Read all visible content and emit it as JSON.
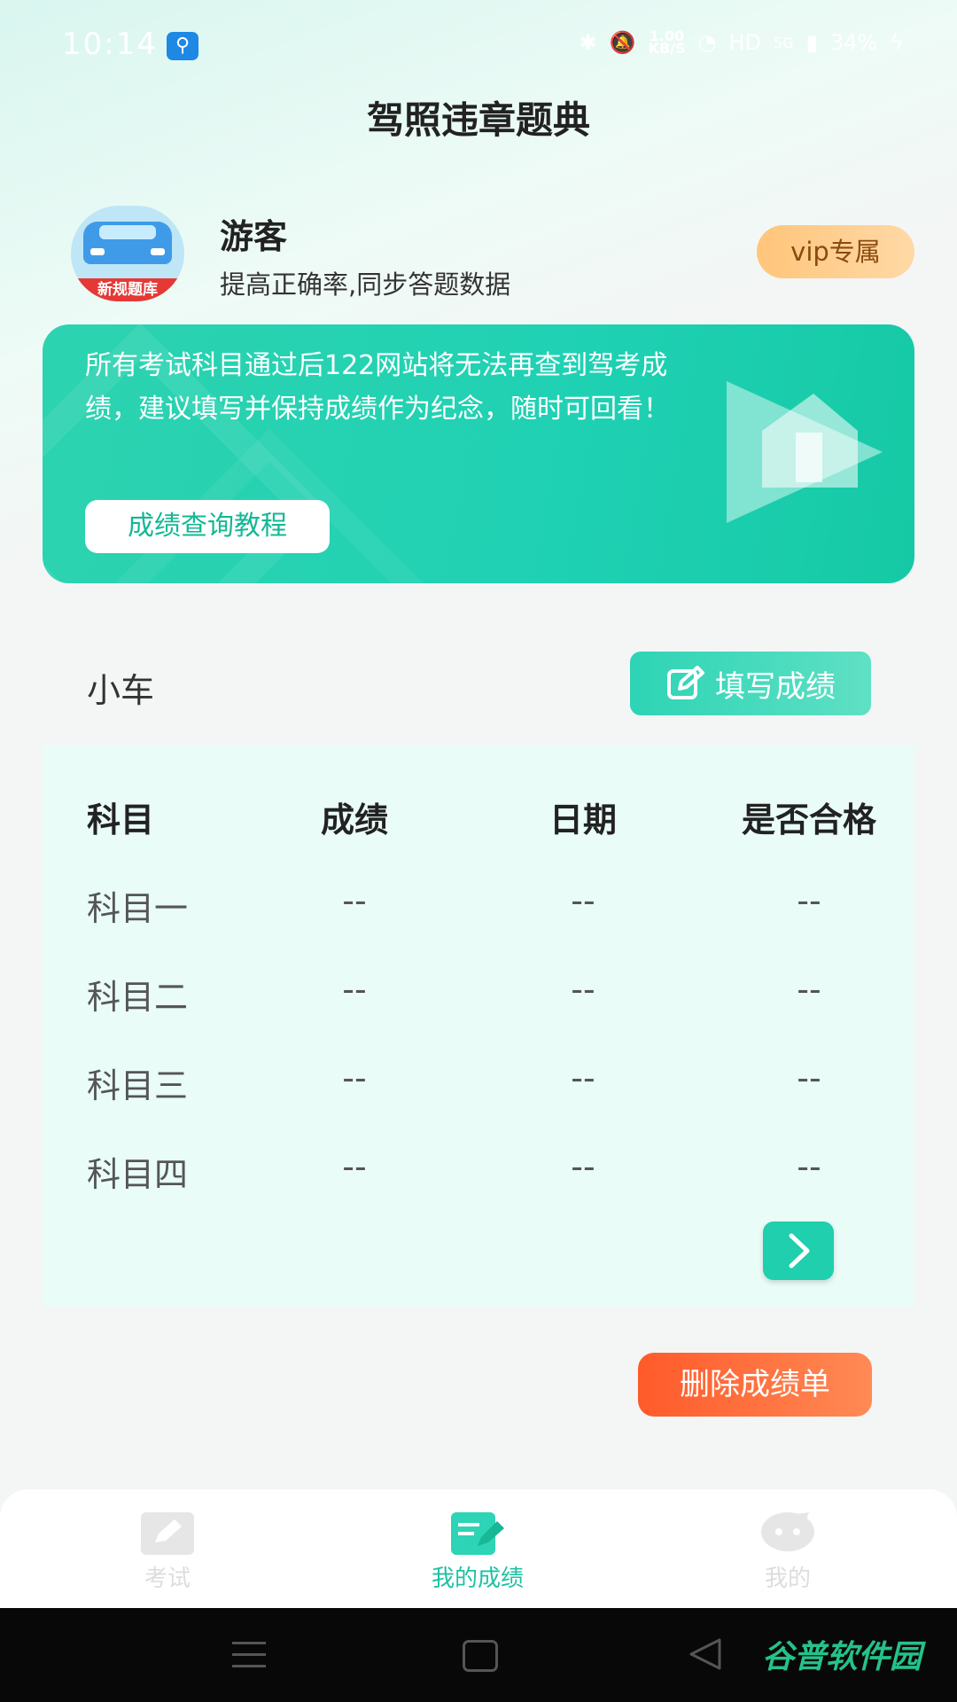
{
  "status_bar": {
    "time": "10:14",
    "net_speed_value": "1.00",
    "net_speed_unit": "KB/S",
    "hd": "HD",
    "network": "5G",
    "battery": "34%"
  },
  "header": {
    "title": "驾照违章题典"
  },
  "profile": {
    "name": "游客",
    "subtitle": "提高正确率,同步答题数据",
    "avatar_tag": "新规题库",
    "vip_label": "vip专属"
  },
  "banner": {
    "text": "所有考试科目通过后122网站将无法再查到驾考成绩，建议填写并保持成绩作为纪念，随时可回看！",
    "button_label": "成绩查询教程"
  },
  "score_section": {
    "vehicle": "小车",
    "fill_button": "填写成绩"
  },
  "score_table": {
    "headers": [
      "科目",
      "成绩",
      "日期",
      "是否合格"
    ],
    "rows": [
      [
        "科目一",
        "--",
        "--",
        "--"
      ],
      [
        "科目二",
        "--",
        "--",
        "--"
      ],
      [
        "科目三",
        "--",
        "--",
        "--"
      ],
      [
        "科目四",
        "--",
        "--",
        "--"
      ]
    ]
  },
  "delete_button": "删除成绩单",
  "tabbar": {
    "items": [
      {
        "label": "考试",
        "icon": "pencil-icon"
      },
      {
        "label": "我的成绩",
        "icon": "score-edit-icon"
      },
      {
        "label": "我的",
        "icon": "chat-face-icon"
      }
    ],
    "active_index": 1
  },
  "watermark": "谷普软件园",
  "colors": {
    "accent": "#1fcfad",
    "delete": "#ff5a2a",
    "vip": "#ffc57a"
  }
}
